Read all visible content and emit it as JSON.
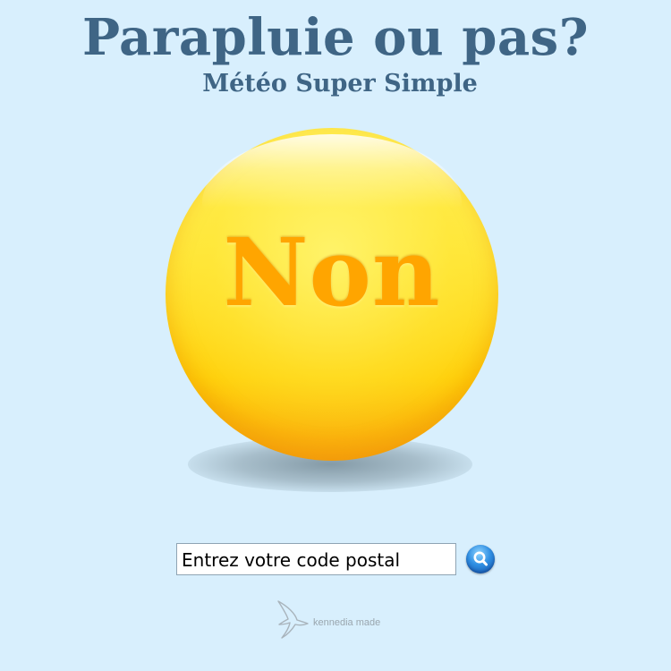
{
  "header": {
    "title": "Parapluie ou pas?",
    "subtitle": "Météo Super Simple"
  },
  "answer": {
    "text": "Non",
    "color": "#ffa500",
    "ball_color": "#ffdf2e"
  },
  "search": {
    "placeholder": "Entrez votre code postal",
    "value": "",
    "button_icon": "search-icon"
  },
  "footer": {
    "logo_icon": "bird-icon",
    "credit": "kennedia made"
  },
  "colors": {
    "background": "#d8effd",
    "title": "#3f6585",
    "search_button": "#2f8fe3"
  }
}
